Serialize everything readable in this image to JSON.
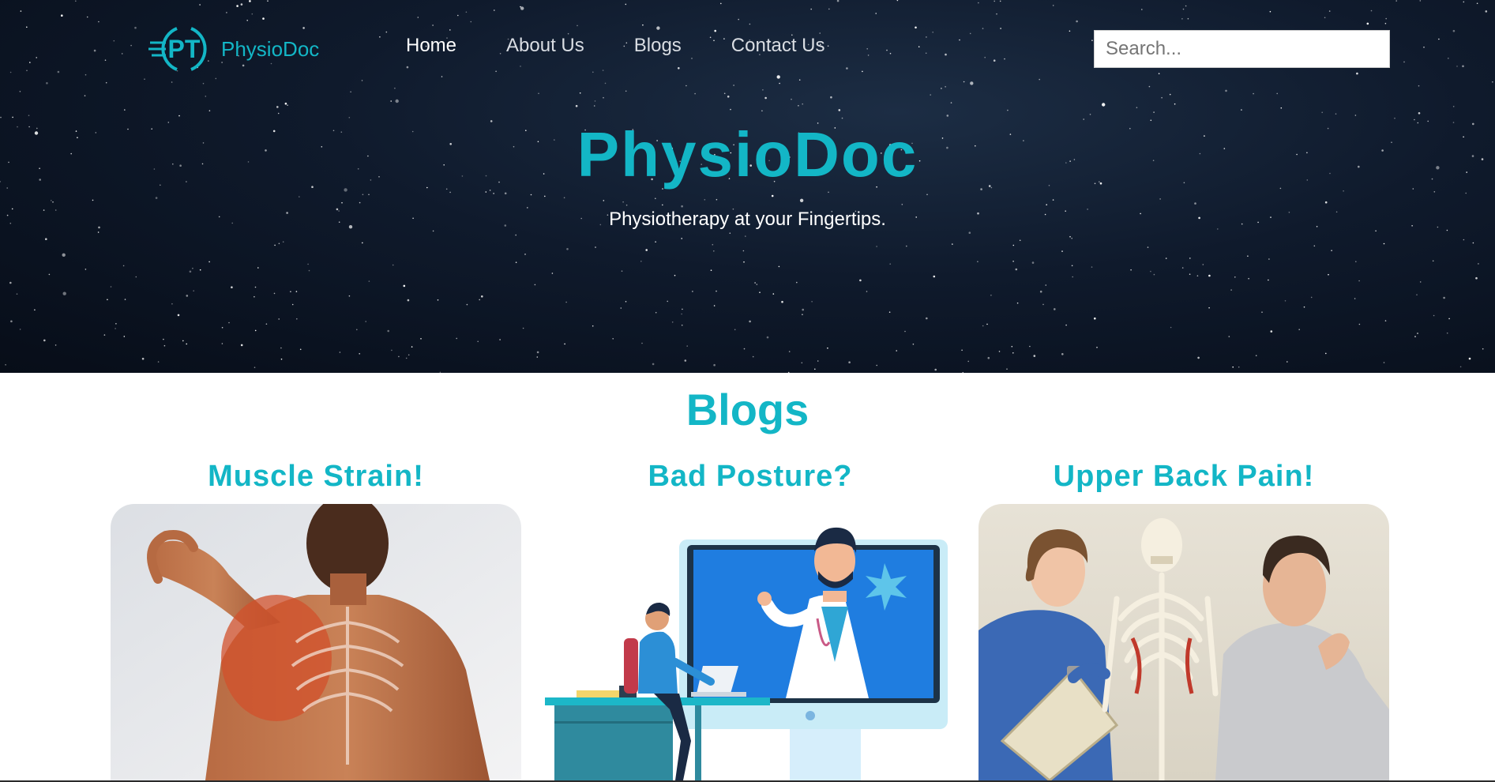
{
  "header": {
    "logo_text": "PhysioDoc",
    "logo_badge": "PT",
    "nav": [
      {
        "label": "Home",
        "active": true
      },
      {
        "label": "About Us",
        "active": false
      },
      {
        "label": "Blogs",
        "active": false
      },
      {
        "label": "Contact Us",
        "active": false
      }
    ],
    "search_placeholder": "Search..."
  },
  "hero": {
    "title": "PhysioDoc",
    "subtitle": "Physiotherapy at your Fingertips."
  },
  "blogs": {
    "heading": "Blogs",
    "cards": [
      {
        "title": "Muscle Strain!",
        "image": "muscle-strain-image"
      },
      {
        "title": "Bad Posture?",
        "image": "bad-posture-illustration"
      },
      {
        "title": "Upper Back Pain!",
        "image": "upper-back-pain-image"
      }
    ]
  },
  "colors": {
    "accent": "#13b6c6",
    "hero_bg": "#0f1a2c",
    "white": "#ffffff"
  }
}
